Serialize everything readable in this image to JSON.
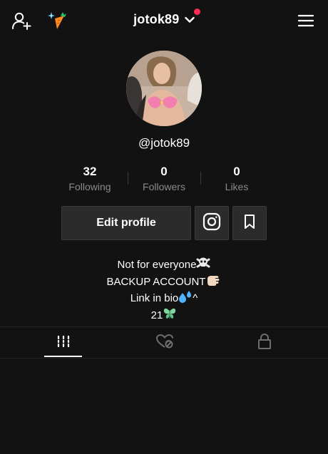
{
  "header": {
    "username": "jotok89",
    "icons": [
      "add-user-icon",
      "carrot-sparkle-icon",
      "chevron-down-icon",
      "menu-icon"
    ],
    "notification_dot_color": "#fe2c55"
  },
  "profile": {
    "handle": "@jotok89"
  },
  "stats": [
    {
      "value": "32",
      "label": "Following"
    },
    {
      "value": "0",
      "label": "Followers"
    },
    {
      "value": "0",
      "label": "Likes"
    }
  ],
  "actions": {
    "edit_label": "Edit profile",
    "icons": [
      "instagram-icon",
      "bookmark-icon"
    ]
  },
  "bio": {
    "lines": [
      {
        "text": "Not for everyone",
        "emoji": "skull-crossbones"
      },
      {
        "text": "BACKUP ACCOUNT",
        "emoji": "thumbs-left-hand"
      },
      {
        "text": "Link in bio",
        "emoji": "sweat-droplets",
        "suffix": "^"
      },
      {
        "text": "21",
        "emoji": "butterfly"
      }
    ]
  },
  "tabs": {
    "icons": [
      "grid-icon",
      "liked-icon",
      "lock-icon"
    ],
    "active_index": 0
  }
}
